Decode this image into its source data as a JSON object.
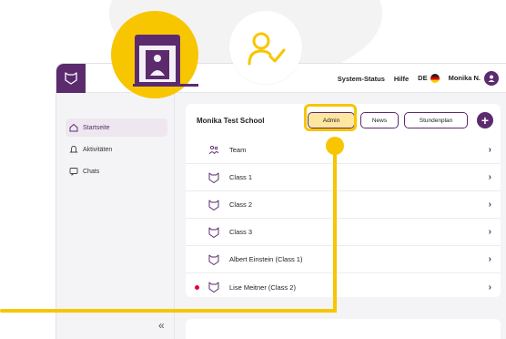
{
  "topbar": {
    "links": [
      "System-Status",
      "Hilfe"
    ],
    "language": "DE",
    "user": "Monika N."
  },
  "sidebar": {
    "items": [
      {
        "label": "Startseite",
        "icon": "home-icon",
        "active": true
      },
      {
        "label": "Aktivitäten",
        "icon": "bell-icon",
        "active": false
      },
      {
        "label": "Chats",
        "icon": "chat-icon",
        "active": false
      }
    ],
    "collapse": "«"
  },
  "school": {
    "name": "Monika Test School",
    "buttons": {
      "admin": "Admin",
      "news": "News",
      "schedule": "Stundenplan"
    },
    "plus": "+",
    "rows": [
      {
        "name": "Team",
        "icon": "team-icon",
        "unread": false
      },
      {
        "name": "Class 1",
        "icon": "fox-icon",
        "unread": false
      },
      {
        "name": "Class 2",
        "icon": "fox-icon",
        "unread": false
      },
      {
        "name": "Class 3",
        "icon": "fox-icon",
        "unread": false
      },
      {
        "name": "Albert Einstein (Class 1)",
        "icon": "fox-icon",
        "unread": false
      },
      {
        "name": "Lise Meitner (Class 2)",
        "icon": "fox-icon",
        "unread": true
      }
    ],
    "chevron": "›"
  },
  "colors": {
    "brand": "#5b2b6e",
    "accent": "#f7c600",
    "unread": "#e4003a"
  }
}
